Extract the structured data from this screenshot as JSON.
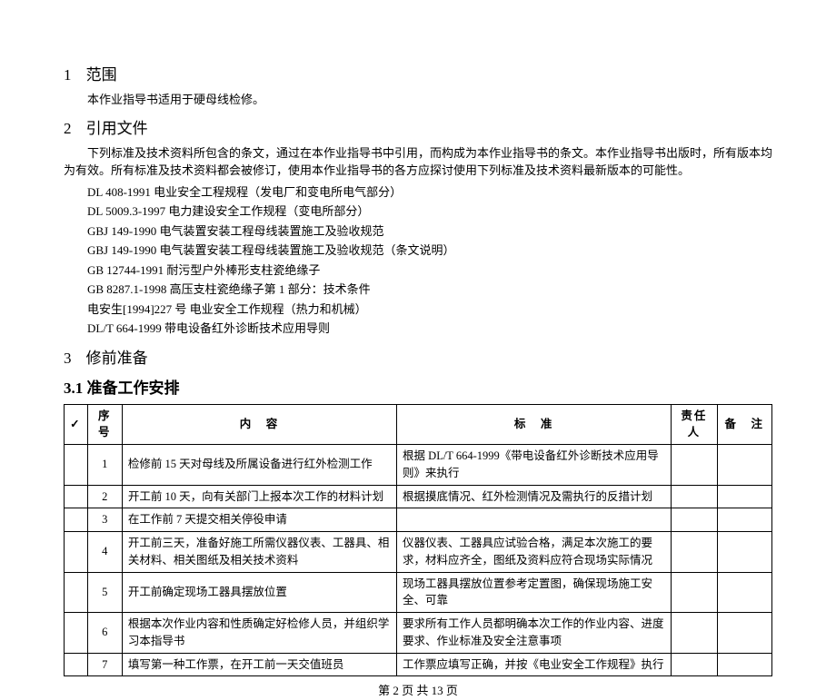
{
  "sections": {
    "s1": {
      "num": "1",
      "title": "范围",
      "body": "本作业指导书适用于硬母线检修。"
    },
    "s2": {
      "num": "2",
      "title": "引用文件",
      "body": "下列标准及技术资料所包含的条文，通过在本作业指导书中引用，而构成为本作业指导书的条文。本作业指导书出版时，所有版本均为有效。所有标准及技术资料都会被修订，使用本作业指导书的各方应探讨使用下列标准及技术资料最新版本的可能性。",
      "refs": [
        "DL 408-1991 电业安全工程规程（发电厂和变电所电气部分）",
        "DL 5009.3-1997 电力建设安全工作规程（变电所部分）",
        "GBJ 149-1990 电气装置安装工程母线装置施工及验收规范",
        "GBJ 149-1990 电气装置安装工程母线装置施工及验收规范（条文说明）",
        "GB 12744-1991 耐污型户外棒形支柱瓷绝缘子",
        "GB 8287.1-1998 高压支柱瓷绝缘子第 1 部分：技术条件",
        "电安生[1994]227 号 电业安全工作规程（热力和机械）",
        "DL/T 664-1999 带电设备红外诊断技术应用导则"
      ]
    },
    "s3": {
      "num": "3",
      "title": "修前准备"
    },
    "s31": {
      "num": "3.1",
      "title": "准备工作安排"
    }
  },
  "table": {
    "headers": {
      "check": "✓",
      "seq": "序号",
      "content": "内　容",
      "standard": "标　准",
      "resp": "责任人",
      "note": "备　注"
    },
    "rows": [
      {
        "seq": "1",
        "content": "检修前 15 天对母线及所属设备进行红外检测工作",
        "standard": "根据 DL/T 664-1999《带电设备红外诊断技术应用导则》来执行"
      },
      {
        "seq": "2",
        "content": "开工前 10 天，向有关部门上报本次工作的材料计划",
        "standard": "根据摸底情况、红外检测情况及需执行的反措计划"
      },
      {
        "seq": "3",
        "content": "在工作前 7 天提交相关停役申请",
        "standard": ""
      },
      {
        "seq": "4",
        "content": "开工前三天，准备好施工所需仪器仪表、工器具、相关材料、相关图纸及相关技术资料",
        "standard": "仪器仪表、工器具应试验合格，满足本次施工的要求，材料应齐全，图纸及资料应符合现场实际情况"
      },
      {
        "seq": "5",
        "content": "开工前确定现场工器具摆放位置",
        "standard": "现场工器具摆放位置参考定置图，确保现场施工安全、可靠"
      },
      {
        "seq": "6",
        "content": "根据本次作业内容和性质确定好检修人员，并组织学习本指导书",
        "standard": "要求所有工作人员都明确本次工作的作业内容、进度要求、作业标准及安全注意事项"
      },
      {
        "seq": "7",
        "content": "填写第一种工作票，在开工前一天交值班员",
        "standard": "工作票应填写正确，并按《电业安全工作规程》执行"
      }
    ]
  },
  "footer": "第 2 页 共 13 页"
}
